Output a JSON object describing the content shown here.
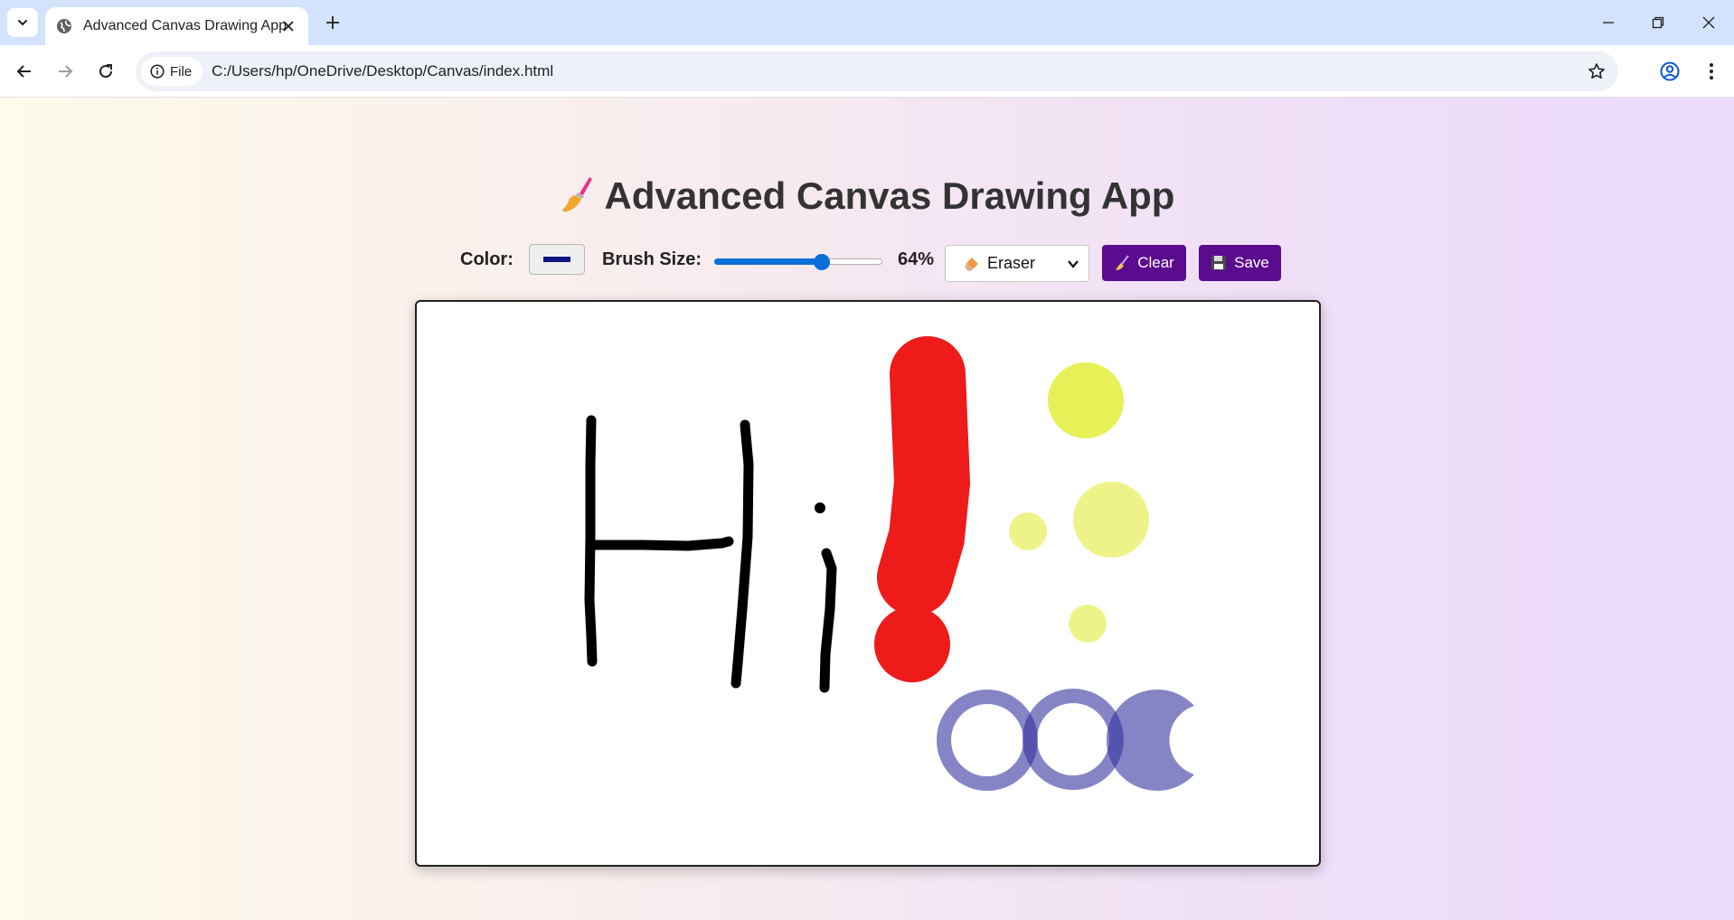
{
  "browser": {
    "tab_title": "Advanced Canvas Drawing App",
    "address_chip": "File",
    "url": "C:/Users/hp/OneDrive/Desktop/Canvas/index.html"
  },
  "app": {
    "title": "Advanced Canvas Drawing App",
    "title_icon": "paintbrush-icon",
    "color_label": "Color:",
    "selected_color": "#0d1580",
    "brush_size_label": "Brush Size:",
    "brush_size_value": 64,
    "brush_size_display": "64%",
    "tool_selected": "Eraser",
    "tool_icon": "eraser-icon",
    "clear_label": "Clear",
    "clear_icon": "broom-icon",
    "save_label": "Save",
    "save_icon": "floppy-disk-icon",
    "accent_color": "#5b0b8d"
  },
  "drawing": {
    "text_drawn": "Hi!",
    "stroke_color": "#000000",
    "exclamation_color": "#ee1b1b",
    "yellow_dots_color": "#e8ef4d",
    "ring_color": "#6b6bbd"
  }
}
